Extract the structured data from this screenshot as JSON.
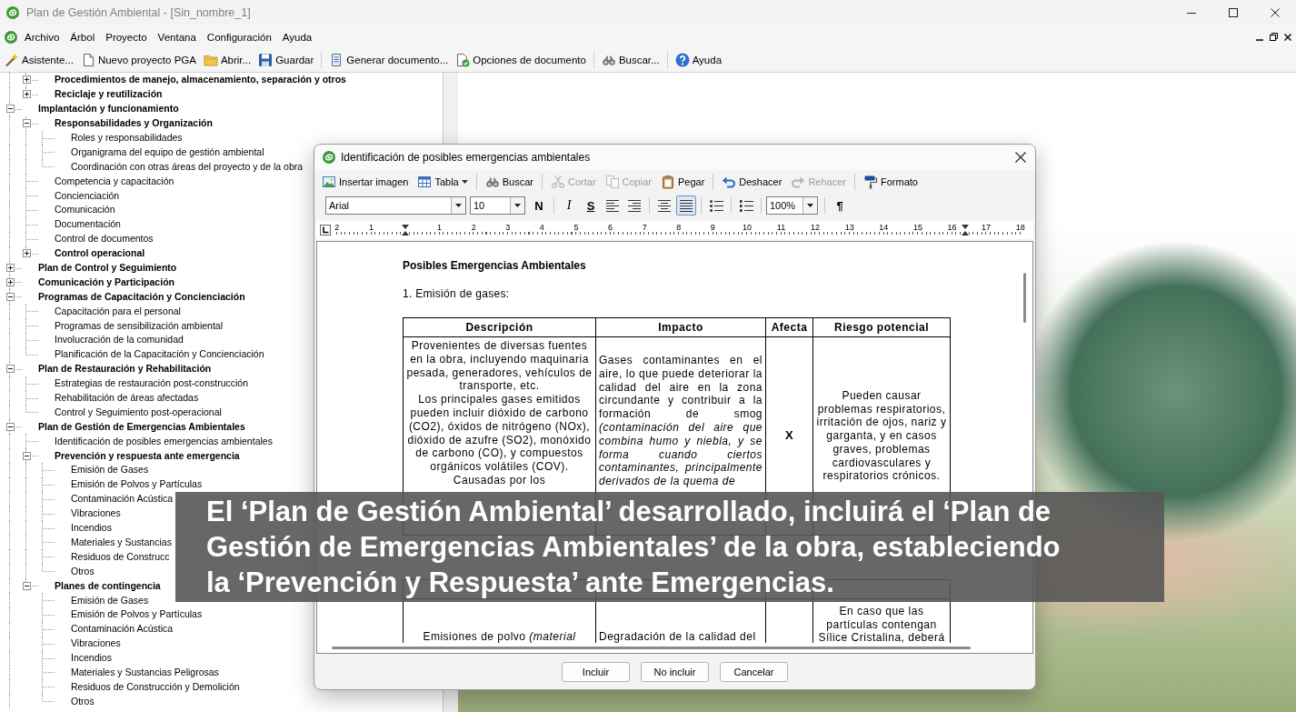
{
  "window": {
    "title": "Plan de Gestión Ambiental - [Sin_nombre_1]"
  },
  "menu": [
    "Archivo",
    "Árbol",
    "Proyecto",
    "Ventana",
    "Configuración",
    "Ayuda"
  ],
  "toolbar": {
    "groups": [
      [
        "Asistente...",
        "Nuevo proyecto PGA",
        "Abrir...",
        "Guardar"
      ],
      [
        "Generar documento...",
        "Opciones de documento"
      ],
      [
        "Buscar..."
      ],
      [
        "Ayuda"
      ]
    ]
  },
  "tree": {
    "partial_branch": [
      {
        "label": "Procedimientos de manejo, almacenamiento, separación y otros",
        "expanded": false
      },
      {
        "label": "Reciclaje y reutilización",
        "expanded": false
      }
    ],
    "items": [
      {
        "label": "Implantación y funcionamiento",
        "expanded": true,
        "children": [
          {
            "label": "Responsabilidades y Organización",
            "expanded": true,
            "children": [
              {
                "label": "Roles y responsabilidades"
              },
              {
                "label": "Organigrama del equipo de gestión ambiental"
              },
              {
                "label": "Coordinación con otras áreas del proyecto y de la obra"
              }
            ]
          },
          {
            "label": "Competencia y capacitación"
          },
          {
            "label": "Concienciación"
          },
          {
            "label": "Comunicación"
          },
          {
            "label": "Documentación"
          },
          {
            "label": "Control de documentos"
          },
          {
            "label": "Control operacional",
            "expanded": false
          }
        ]
      },
      {
        "label": "Plan de Control y Seguimiento",
        "expanded": false
      },
      {
        "label": "Comunicación y Participación",
        "expanded": false
      },
      {
        "label": "Programas de Capacitación y Concienciación",
        "expanded": true,
        "children": [
          {
            "label": "Capacitación para el personal"
          },
          {
            "label": "Programas de sensibilización ambiental"
          },
          {
            "label": "Involucración de la comunidad"
          },
          {
            "label": "Planificación de la Capacitación y Concienciación"
          }
        ]
      },
      {
        "label": "Plan de Restauración y Rehabilitación",
        "expanded": true,
        "children": [
          {
            "label": "Estrategias de restauración post-construcción"
          },
          {
            "label": "Rehabilitación de áreas afectadas"
          },
          {
            "label": "Control y Seguimiento post-operacional"
          }
        ]
      },
      {
        "label": "Plan de Gestión de Emergencias Ambientales",
        "expanded": true,
        "children": [
          {
            "label": "Identificación de posibles emergencias ambientales"
          },
          {
            "label": "Prevención y respuesta ante emergencia",
            "expanded": true,
            "children": [
              {
                "label": "Emisión de Gases"
              },
              {
                "label": "Emisión de Polvos y Partículas"
              },
              {
                "label": "Contaminación Acústica"
              },
              {
                "label": "Vibraciones"
              },
              {
                "label": "Incendios"
              },
              {
                "label": "Materiales y Sustancias"
              },
              {
                "label": "Residuos de Construcc"
              },
              {
                "label": "Otros"
              }
            ]
          },
          {
            "label": "Planes de contingencia",
            "expanded": true,
            "children": [
              {
                "label": "Emisión de Gases"
              },
              {
                "label": "Emisión de Polvos y Partículas"
              },
              {
                "label": "Contaminación Acústica"
              },
              {
                "label": "Vibraciones"
              },
              {
                "label": "Incendios"
              },
              {
                "label": "Materiales y Sustancias Peligrosas"
              },
              {
                "label": "Residuos de Construcción y Demolición"
              },
              {
                "label": "Otros"
              }
            ]
          }
        ]
      }
    ]
  },
  "dialog": {
    "title": "Identificación de posibles emergencias ambientales",
    "toolbar": {
      "groups": [
        [
          {
            "kind": "button",
            "label": "Insertar imagen",
            "disabled": false
          },
          {
            "kind": "dropdown",
            "label": "Tabla",
            "disabled": false
          }
        ],
        [
          {
            "kind": "button",
            "label": "Buscar",
            "disabled": false
          }
        ],
        [
          {
            "kind": "button",
            "label": "Cortar",
            "disabled": true
          },
          {
            "kind": "button",
            "label": "Copiar",
            "disabled": true
          },
          {
            "kind": "button",
            "label": "Pegar",
            "disabled": false
          }
        ],
        [
          {
            "kind": "button",
            "label": "Deshacer",
            "disabled": false
          },
          {
            "kind": "button",
            "label": "Rehacer",
            "disabled": true
          }
        ],
        [
          {
            "kind": "button",
            "label": "Formato",
            "disabled": false
          }
        ]
      ]
    },
    "format_bar": {
      "groups": [
        [
          {
            "kind": "font",
            "value": "Arial"
          },
          {
            "kind": "size",
            "value": "10"
          },
          {
            "kind": "bold",
            "label": "N",
            "selected": false
          }
        ],
        [
          {
            "kind": "italic",
            "label": "I",
            "selected": false
          },
          {
            "kind": "underline",
            "label": "S",
            "selected": false
          },
          {
            "kind": "left",
            "selected": false
          },
          {
            "kind": "right",
            "selected": false
          }
        ],
        [
          {
            "kind": "center",
            "selected": false
          },
          {
            "kind": "justify",
            "selected": true
          }
        ],
        [
          {
            "kind": "bullets",
            "selected": false
          }
        ],
        [
          {
            "kind": "numbering",
            "selected": false
          }
        ],
        [
          {
            "kind": "zoom",
            "value": "100%"
          }
        ],
        [
          {
            "kind": "pilcrow",
            "label": "¶",
            "selected": false
          }
        ]
      ]
    },
    "ruler": {
      "left_labels": [
        "2",
        "1"
      ],
      "labels": [
        "1",
        "2",
        "3",
        "4",
        "5",
        "6",
        "7",
        "8",
        "9",
        "10",
        "11",
        "12",
        "13",
        "14",
        "15",
        "16",
        "17",
        "18"
      ]
    },
    "document": {
      "heading": "Posibles Emergencias Ambientales",
      "subheading": "1. Emisión de gases:",
      "tables": [
        {
          "columns": [
            "Descripción",
            "Impacto",
            "Afecta",
            "Riesgo potencial"
          ],
          "rows": [
            {
              "description": "Provenientes de diversas fuentes en la obra, incluyendo maquinaria pesada, generadores, vehículos de transporte, etc.\nLos principales gases emitidos pueden incluir dióxido de carbono (CO2), óxidos de nitrógeno (NOx), dióxido de azufre (SO2), monóxido de carbono (CO), y compuestos orgánicos volátiles (COV). Causadas por los",
              "impact": "Gases contaminantes en el aire, lo que puede deteriorar la calidad del aire en la zona circundante y contribuir a la formación de smog *(contaminación del aire que combina humo y niebla, y se forma cuando ciertos contaminantes, principalmente derivados de la quema de*",
              "affects": "X",
              "risk": "Pueden causar problemas respiratorios, irritación de ojos, nariz y garganta, y en casos graves, problemas cardiovasculares y respiratorios crónicos."
            }
          ]
        },
        {
          "rows": [
            {
              "description": "Emisiones de polvo *(material*",
              "impact": "Degradación de la calidad del",
              "risk": "En caso que las partículas contengan Sílice Cristalina, deberá"
            }
          ]
        }
      ]
    },
    "buttons": [
      "Incluir",
      "No incluir",
      "Cancelar"
    ]
  },
  "caption": "El ‘Plan de Gestión Ambiental’ desarrollado, incluirá el ‘Plan de Gestión de Emergencias Ambientales’ de la obra, estableciendo la ‘Prevención y Respuesta’ ante Emergencias."
}
